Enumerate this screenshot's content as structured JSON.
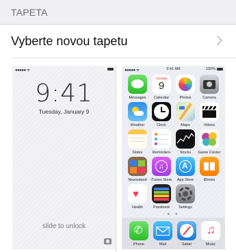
{
  "section_header": "TAPETA",
  "choose_row": {
    "label": "Vyberte novou tapetu"
  },
  "lock_screen": {
    "status_dots": "●●●●● ᯤ",
    "time": "9:41",
    "date": "Tuesday, January 9",
    "unlock_text": "slide to unlock"
  },
  "home_screen": {
    "status_dots": "●●●●● ᯤ",
    "status_time": "9:41 AM",
    "status_battery": "100%",
    "calendar_day": "Tuesday",
    "calendar_date": "9",
    "apps": [
      "Messages",
      "Calendar",
      "Photos",
      "Camera",
      "Weather",
      "Clock",
      "Maps",
      "Videos",
      "Notes",
      "Reminders",
      "Stocks",
      "Game Center",
      "Newsstand",
      "iTunes Store",
      "App Store",
      "iBooks",
      "Health",
      "Passbook",
      "Settings"
    ],
    "page_dots": "● ●",
    "dock": [
      "Phone",
      "Mail",
      "Safari",
      "Music"
    ]
  },
  "colors": {
    "accent": "#c7c7cc",
    "header_bg": "#efeff4"
  }
}
